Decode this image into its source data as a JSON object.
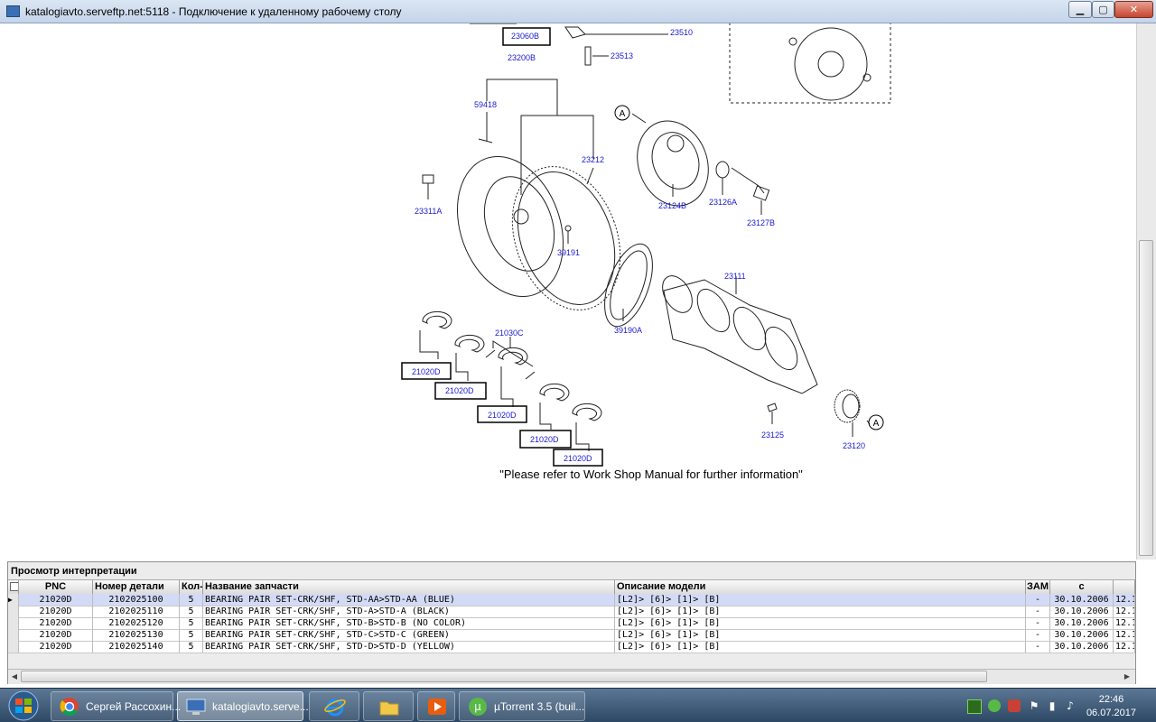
{
  "window": {
    "title": "katalogiavto.serveftp.net:5118 - Подключение к удаленному рабочему столу",
    "minimize": "▁",
    "maximize": "▢",
    "close": "✕"
  },
  "diagram": {
    "note": "\"Please refer to Work Shop Manual for further information\"",
    "labels": [
      "23060B",
      "23510",
      "23513",
      "23200B",
      "59418",
      "23212",
      "23311A",
      "39191",
      "23124B",
      "23126A",
      "23127B",
      "23111",
      "39190A",
      "21030C",
      "21020D",
      "21020D",
      "21020D",
      "21020D",
      "21020D",
      "23125",
      "23120",
      "A",
      "A"
    ]
  },
  "panel": {
    "title": "Просмотр интерпретации",
    "columns": [
      "PNC",
      "Номер детали",
      "Кол-",
      "Название запчасти",
      "Описание модели",
      "ЗАМ",
      "c"
    ],
    "rows": [
      {
        "pnc": "21020D",
        "part": "2102025100",
        "qty": "5",
        "name": "BEARING PAIR SET-CRK/SHF, STD-AA>STD-AA (BLUE)",
        "model": "[L2]> [6]> [1]> [B]",
        "zam": "-",
        "from": "30.10.2006",
        "to": "12.1"
      },
      {
        "pnc": "21020D",
        "part": "2102025110",
        "qty": "5",
        "name": "BEARING PAIR SET-CRK/SHF, STD-A>STD-A (BLACK)",
        "model": "[L2]> [6]> [1]> [B]",
        "zam": "-",
        "from": "30.10.2006",
        "to": "12.1"
      },
      {
        "pnc": "21020D",
        "part": "2102025120",
        "qty": "5",
        "name": "BEARING PAIR SET-CRK/SHF, STD-B>STD-B (NO COLOR)",
        "model": "[L2]> [6]> [1]> [B]",
        "zam": "-",
        "from": "30.10.2006",
        "to": "12.1"
      },
      {
        "pnc": "21020D",
        "part": "2102025130",
        "qty": "5",
        "name": "BEARING PAIR SET-CRK/SHF, STD-C>STD-C (GREEN)",
        "model": "[L2]> [6]> [1]> [B]",
        "zam": "-",
        "from": "30.10.2006",
        "to": "12.1"
      },
      {
        "pnc": "21020D",
        "part": "2102025140",
        "qty": "5",
        "name": "BEARING PAIR SET-CRK/SHF, STD-D>STD-D (YELLOW)",
        "model": "[L2]> [6]> [1]> [B]",
        "zam": "-",
        "from": "30.10.2006",
        "to": "12.1"
      }
    ]
  },
  "taskbar": {
    "items": [
      {
        "label": "Сергей Рассохин...",
        "icon": "chrome-icon"
      },
      {
        "label": "katalogiavto.serve...",
        "icon": "remote-desktop-icon"
      },
      {
        "label": "",
        "icon": "internet-explorer-icon"
      },
      {
        "label": "",
        "icon": "folder-icon"
      },
      {
        "label": "",
        "icon": "media-player-icon"
      },
      {
        "label": "µTorrent 3.5  (buil...",
        "icon": "utorrent-icon"
      }
    ],
    "time": "22:46",
    "date": "06.07.2017"
  },
  "colors": {
    "link": "#1a1ad0",
    "selected_row": "#d3daf5",
    "taskbar": "#2c4763"
  }
}
